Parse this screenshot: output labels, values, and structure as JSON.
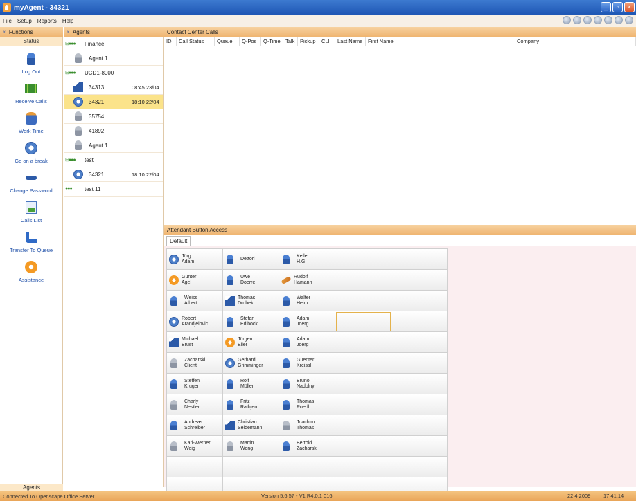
{
  "window": {
    "title": "myAgent - 34321"
  },
  "menu": [
    "File",
    "Setup",
    "Reports",
    "Help"
  ],
  "panels": {
    "functions_title": "Functions",
    "agents_title": "Agents",
    "calls_title": "Contact Center Calls",
    "aba_title": "Attendant Button Access"
  },
  "functions": {
    "status_label": "Status",
    "items": [
      {
        "label": "Log Out",
        "icon": "person-icon"
      },
      {
        "label": "Receive Calls",
        "icon": "grid-icon"
      },
      {
        "label": "Work Time",
        "icon": "worker-icon"
      },
      {
        "label": "Go on a break",
        "icon": "clock-icon"
      },
      {
        "label": "Change Password",
        "icon": "key-icon"
      },
      {
        "label": "Calls List",
        "icon": "document-icon"
      },
      {
        "label": "Transfer To Queue",
        "icon": "transfer-icon"
      },
      {
        "label": "Assistance",
        "icon": "assistance-icon"
      }
    ],
    "agents_label": "Agents"
  },
  "agents": [
    {
      "type": "group",
      "name": "Finance"
    },
    {
      "type": "agent",
      "name": "Agent 1",
      "time": "",
      "icon": "person-grey-icon",
      "selected": false
    },
    {
      "type": "group",
      "name": "UCD1-8000"
    },
    {
      "type": "agent",
      "name": "34313",
      "time": "08:45 23/04",
      "icon": "house-icon",
      "selected": false
    },
    {
      "type": "agent",
      "name": "34321",
      "time": "18:10 22/04",
      "icon": "clock-icon",
      "selected": true
    },
    {
      "type": "agent",
      "name": "35754",
      "time": "",
      "icon": "person-grey-icon",
      "selected": false
    },
    {
      "type": "agent",
      "name": "41892",
      "time": "",
      "icon": "person-grey-icon",
      "selected": false
    },
    {
      "type": "agent",
      "name": "Agent 1",
      "time": "",
      "icon": "person-grey-icon",
      "selected": false
    },
    {
      "type": "group",
      "name": "test"
    },
    {
      "type": "agent",
      "name": "34321",
      "time": "18:10 22/04",
      "icon": "clock-icon",
      "selected": false
    },
    {
      "type": "group",
      "name": "test 11"
    }
  ],
  "calls_columns": [
    "ID",
    "Call Status",
    "Queue",
    "Q-Pos",
    "Q-Time",
    "Talk",
    "Pickup",
    "CLI",
    "Last Name",
    "First Name",
    "Company"
  ],
  "aba": {
    "tab": "Default",
    "rows": [
      [
        {
          "l1": "Jörg",
          "l2": "Adam",
          "icon": "clock-icon"
        },
        {
          "l1": "",
          "l2": "Dettori",
          "icon": "person-blue-icon"
        },
        {
          "l1": "Keller",
          "l2": "H.G.",
          "icon": "person-blue-icon"
        },
        null,
        null
      ],
      [
        {
          "l1": "Günter",
          "l2": "Agel",
          "icon": "sun-icon"
        },
        {
          "l1": "Uwe",
          "l2": "Doerre",
          "icon": "person-blue-icon"
        },
        {
          "l1": "Rudolf",
          "l2": "Hamann",
          "icon": "phone-icon"
        },
        null,
        null
      ],
      [
        {
          "l1": "Weiss",
          "l2": "Albert",
          "icon": "person-blue-icon"
        },
        {
          "l1": "Thomas",
          "l2": "Drobek",
          "icon": "house-icon"
        },
        {
          "l1": "Walter",
          "l2": "Heim",
          "icon": "person-blue-icon"
        },
        null,
        null
      ],
      [
        {
          "l1": "Robert",
          "l2": "Arandjelovic",
          "icon": "clock-icon"
        },
        {
          "l1": "Stefan",
          "l2": "Edlböck",
          "icon": "person-blue-icon"
        },
        {
          "l1": "Adam",
          "l2": "Joerg",
          "icon": "person-blue-icon"
        },
        "focus",
        null
      ],
      [
        {
          "l1": "Michael",
          "l2": "Brust",
          "icon": "house-icon"
        },
        {
          "l1": "Jürgen",
          "l2": "Eller",
          "icon": "sun-icon"
        },
        {
          "l1": "Adam",
          "l2": "Joerg",
          "icon": "person-blue-icon"
        },
        null,
        null
      ],
      [
        {
          "l1": "Zacharski",
          "l2": "Client",
          "icon": "person-grey-icon"
        },
        {
          "l1": "Gerhard",
          "l2": "Grimminger",
          "icon": "clock-icon"
        },
        {
          "l1": "Guenter",
          "l2": "Kreissl",
          "icon": "person-blue-icon"
        },
        null,
        null
      ],
      [
        {
          "l1": "Steffen",
          "l2": "Kruger",
          "icon": "person-blue-icon"
        },
        {
          "l1": "Rolf",
          "l2": "Müller",
          "icon": "person-blue-icon"
        },
        {
          "l1": "Bruno",
          "l2": "Nadolny",
          "icon": "person-blue-icon"
        },
        null,
        null
      ],
      [
        {
          "l1": "Charly",
          "l2": "Nestler",
          "icon": "person-grey-icon"
        },
        {
          "l1": "Fritz",
          "l2": "Rathjen",
          "icon": "person-blue-icon"
        },
        {
          "l1": "Thomas",
          "l2": "Roedl",
          "icon": "person-blue-icon"
        },
        null,
        null
      ],
      [
        {
          "l1": "Andreas",
          "l2": "Schreiber",
          "icon": "person-blue-icon"
        },
        {
          "l1": "Christian",
          "l2": "Seidemann",
          "icon": "house-icon"
        },
        {
          "l1": "Joachim",
          "l2": "Thomas",
          "icon": "person-grey-icon"
        },
        null,
        null
      ],
      [
        {
          "l1": "Karl-Werner",
          "l2": "Weig",
          "icon": "person-grey-icon"
        },
        {
          "l1": "Martin",
          "l2": "Wong",
          "icon": "person-grey-icon"
        },
        {
          "l1": "Bertold",
          "l2": "Zacharski",
          "icon": "person-blue-icon"
        },
        null,
        null
      ],
      [
        null,
        null,
        null,
        null,
        null
      ],
      [
        null,
        null,
        null,
        null,
        null
      ]
    ]
  },
  "status": {
    "connection": "Connected To Openscape Office Server",
    "version": "Version 5.6.57 - V1 R4.0.1 016",
    "date": "22.4.2009",
    "time": "17:41:14"
  },
  "colors": {
    "accent": "#efb571",
    "title_bar": "#1d55b3",
    "selected_row": "#fbe38a"
  }
}
